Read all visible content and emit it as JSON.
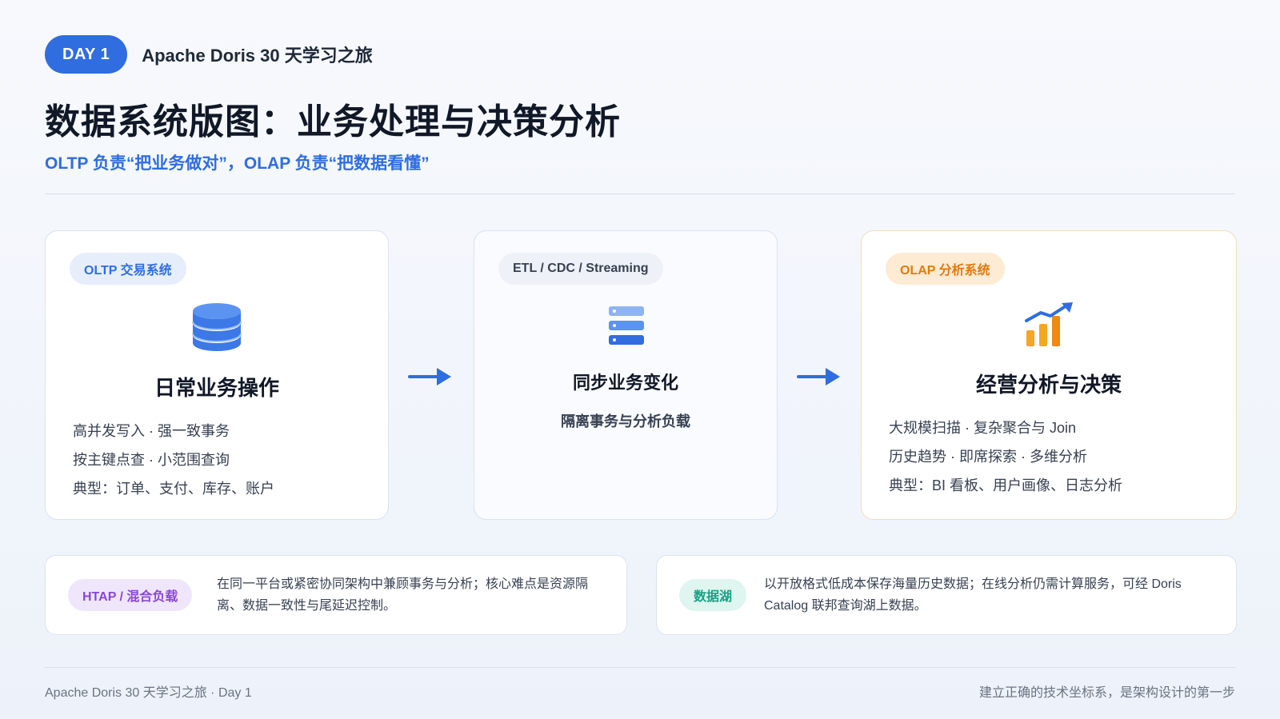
{
  "header": {
    "day_label": "DAY 1",
    "series_title": "Apache Doris 30 天学习之旅"
  },
  "title": "数据系统版图：业务处理与决策分析",
  "subtitle": "OLTP 负责“把业务做对”，OLAP 负责“把数据看懂”",
  "cards": {
    "oltp": {
      "tag": "OLTP 交易系统",
      "icon": "database-icon",
      "heading": "日常业务操作",
      "lines": [
        "高并发写入 · 强一致事务",
        "按主键点查 · 小范围查询",
        "典型：订单、支付、库存、账户"
      ]
    },
    "etl": {
      "tag": "ETL / CDC / Streaming",
      "icon": "server-stack-icon",
      "heading": "同步业务变化",
      "sub": "隔离事务与分析负载"
    },
    "olap": {
      "tag": "OLAP 分析系统",
      "icon": "trend-chart-icon",
      "heading": "经营分析与决策",
      "lines": [
        "大规模扫描 · 复杂聚合与 Join",
        "历史趋势 · 即席探索 · 多维分析",
        "典型：BI 看板、用户画像、日志分析"
      ]
    }
  },
  "bottom": {
    "htap": {
      "tag": "HTAP / 混合负载",
      "text": "在同一平台或紧密协同架构中兼顾事务与分析；核心难点是资源隔离、数据一致性与尾延迟控制。"
    },
    "lake": {
      "tag": "数据湖",
      "text": "以开放格式低成本保存海量历史数据；在线分析仍需计算服务，可经 Doris Catalog 联邦查询湖上数据。"
    }
  },
  "footer": {
    "left": "Apache Doris 30 天学习之旅 · Day 1",
    "right": "建立正确的技术坐标系，是架构设计的第一步"
  },
  "colors": {
    "primary": "#2f6de0",
    "orange": "#e07a12",
    "purple": "#8a47d8",
    "teal": "#17a085"
  }
}
